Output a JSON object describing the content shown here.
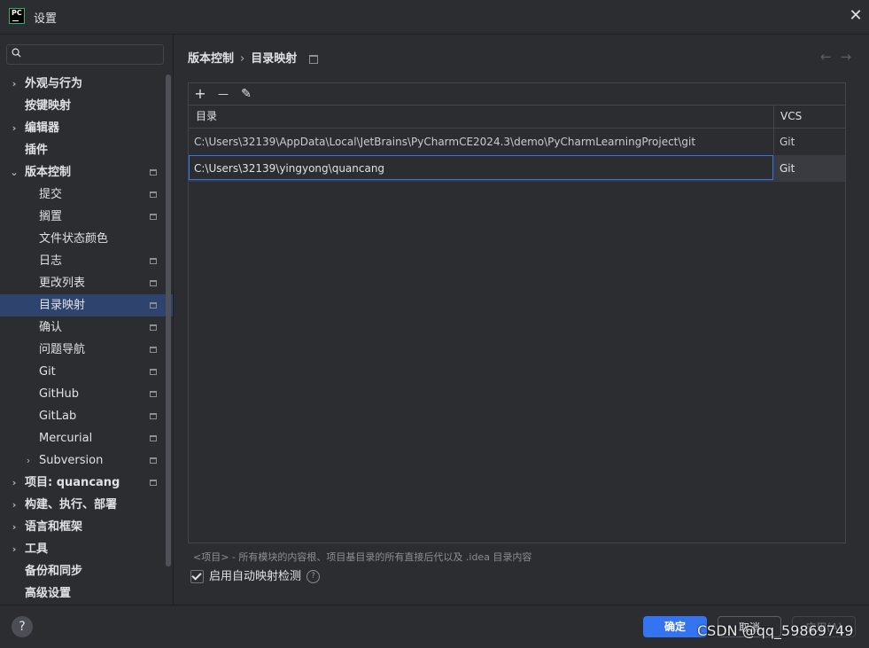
{
  "window": {
    "title": "设置",
    "app_icon_text": "PC"
  },
  "search": {
    "placeholder": ""
  },
  "sidebar": {
    "items": [
      {
        "label": "外观与行为",
        "level": 0,
        "bold": true,
        "expander": "›",
        "pinned": false,
        "selected": false
      },
      {
        "label": "按键映射",
        "level": 0,
        "bold": true,
        "expander": "",
        "pinned": false,
        "selected": false
      },
      {
        "label": "编辑器",
        "level": 0,
        "bold": true,
        "expander": "›",
        "pinned": false,
        "selected": false
      },
      {
        "label": "插件",
        "level": 0,
        "bold": true,
        "expander": "",
        "pinned": false,
        "selected": false
      },
      {
        "label": "版本控制",
        "level": 0,
        "bold": true,
        "expander": "⌄",
        "pinned": true,
        "selected": false
      },
      {
        "label": "提交",
        "level": 1,
        "bold": false,
        "expander": "",
        "pinned": true,
        "selected": false
      },
      {
        "label": "搁置",
        "level": 1,
        "bold": false,
        "expander": "",
        "pinned": true,
        "selected": false
      },
      {
        "label": "文件状态颜色",
        "level": 1,
        "bold": false,
        "expander": "",
        "pinned": false,
        "selected": false
      },
      {
        "label": "日志",
        "level": 1,
        "bold": false,
        "expander": "",
        "pinned": true,
        "selected": false
      },
      {
        "label": "更改列表",
        "level": 1,
        "bold": false,
        "expander": "",
        "pinned": true,
        "selected": false
      },
      {
        "label": "目录映射",
        "level": 1,
        "bold": false,
        "expander": "",
        "pinned": true,
        "selected": true
      },
      {
        "label": "确认",
        "level": 1,
        "bold": false,
        "expander": "",
        "pinned": true,
        "selected": false
      },
      {
        "label": "问题导航",
        "level": 1,
        "bold": false,
        "expander": "",
        "pinned": true,
        "selected": false
      },
      {
        "label": "Git",
        "level": 1,
        "bold": false,
        "expander": "",
        "pinned": true,
        "selected": false
      },
      {
        "label": "GitHub",
        "level": 1,
        "bold": false,
        "expander": "",
        "pinned": true,
        "selected": false
      },
      {
        "label": "GitLab",
        "level": 1,
        "bold": false,
        "expander": "",
        "pinned": true,
        "selected": false
      },
      {
        "label": "Mercurial",
        "level": 1,
        "bold": false,
        "expander": "",
        "pinned": true,
        "selected": false
      },
      {
        "label": "Subversion",
        "level": 1,
        "bold": false,
        "expander": "›",
        "pinned": true,
        "selected": false
      },
      {
        "label": "项目: quancang",
        "level": 0,
        "bold": true,
        "expander": "›",
        "pinned": true,
        "selected": false
      },
      {
        "label": "构建、执行、部署",
        "level": 0,
        "bold": true,
        "expander": "›",
        "pinned": false,
        "selected": false
      },
      {
        "label": "语言和框架",
        "level": 0,
        "bold": true,
        "expander": "›",
        "pinned": false,
        "selected": false
      },
      {
        "label": "工具",
        "level": 0,
        "bold": true,
        "expander": "›",
        "pinned": false,
        "selected": false
      },
      {
        "label": "备份和同步",
        "level": 0,
        "bold": true,
        "expander": "",
        "pinned": false,
        "selected": false
      },
      {
        "label": "高级设置",
        "level": 0,
        "bold": true,
        "expander": "",
        "pinned": false,
        "selected": false
      }
    ]
  },
  "breadcrumb": {
    "parent": "版本控制",
    "separator": "›",
    "current": "目录映射"
  },
  "nav": {
    "back": "←",
    "forward": "→"
  },
  "toolbar": {
    "add": "+",
    "remove": "—",
    "edit": "✎"
  },
  "table": {
    "headers": {
      "directory": "目录",
      "vcs": "VCS"
    },
    "rows": [
      {
        "directory": "C:\\Users\\32139\\AppData\\Local\\JetBrains\\PyCharmCE2024.3\\demo\\PyCharmLearningProject\\git",
        "vcs": "Git"
      },
      {
        "directory": "C:\\Users\\32139\\yingyong\\quancang",
        "vcs": "Git"
      }
    ]
  },
  "note": "<项目> - 所有模块的内容根、项目基目录的所有直接后代以及 .idea 目录内容",
  "auto_detect": {
    "label": "启用自动映射检测",
    "checked": true,
    "help": "?"
  },
  "footer": {
    "help": "?",
    "ok": "确定",
    "cancel": "取消",
    "apply": "应用(A)"
  },
  "watermark": "CSDN @qq_59869749",
  "colors": {
    "accent": "#3574f0",
    "selection": "#2e436e",
    "background": "#2b2d30"
  }
}
